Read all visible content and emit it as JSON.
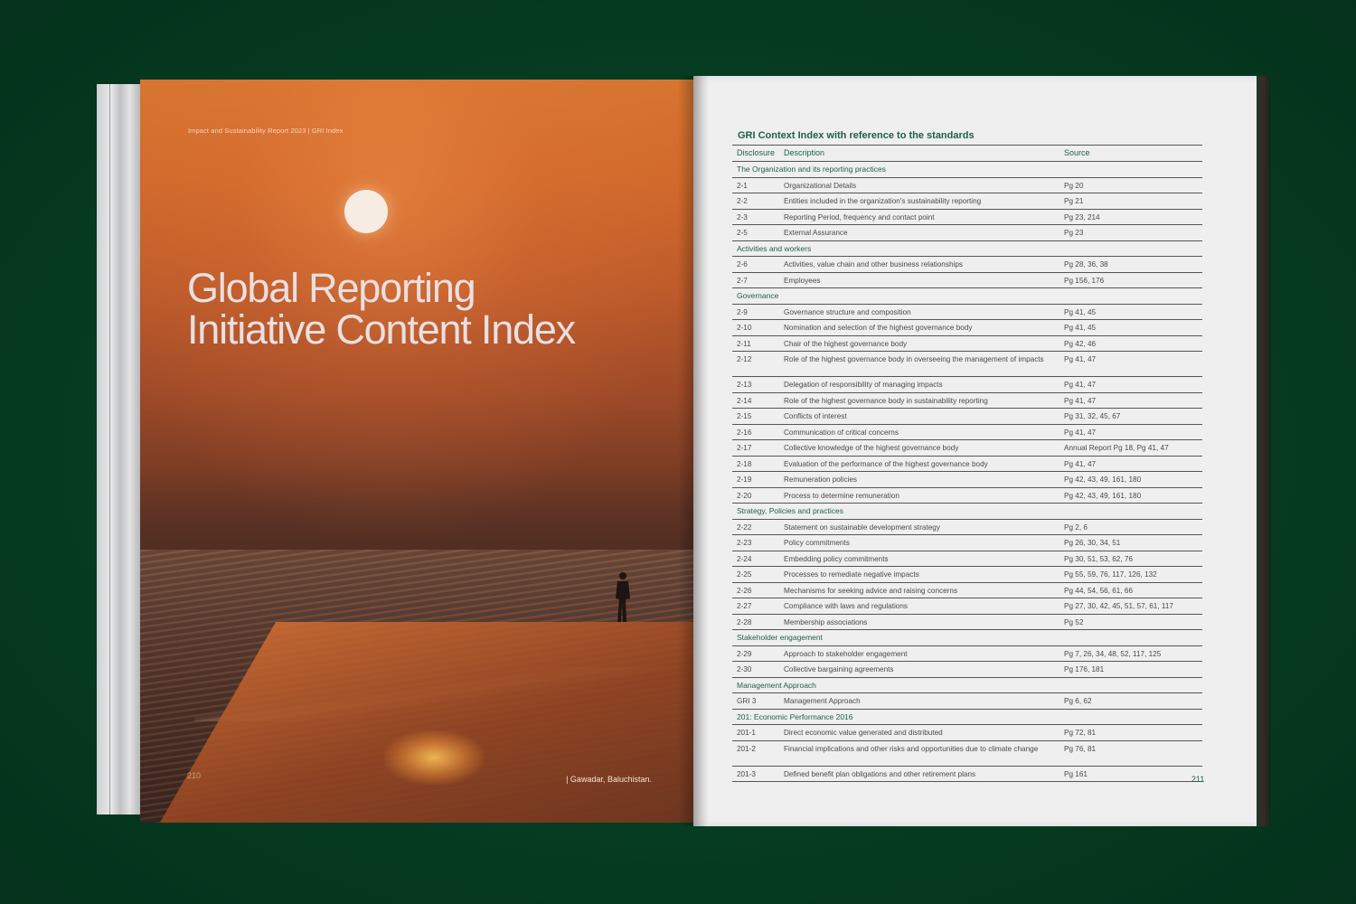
{
  "left_page": {
    "running_head": "Impact and Sustainability Report 2023 | GRI Index",
    "title_line1": "Global Reporting",
    "title_line2": "Initiative Content Index",
    "page_number": "210",
    "caption": "| Gawadar, Baluchistan."
  },
  "right_page": {
    "table_title": "GRI Context Index with reference to the standards",
    "headers": {
      "disclosure": "Disclosure",
      "description": "Description",
      "source": "Source"
    },
    "page_number": "211",
    "sections": [
      {
        "title": "The Organization and its reporting practices",
        "rows": [
          {
            "code": "2-1",
            "desc": "Organizational Details",
            "src": "Pg 20"
          },
          {
            "code": "2-2",
            "desc": "Entities included in the organization's sustainability reporting",
            "src": "Pg 21"
          },
          {
            "code": "2-3",
            "desc": "Reporting Period, frequency and contact point",
            "src": "Pg 23, 214"
          },
          {
            "code": "2-5",
            "desc": "External Assurance",
            "src": "Pg 23"
          }
        ]
      },
      {
        "title": "Activities and workers",
        "rows": [
          {
            "code": "2-6",
            "desc": "Activities, value chain and other business relationships",
            "src": "Pg 28, 36, 38"
          },
          {
            "code": "2-7",
            "desc": "Employees",
            "src": "Pg 156, 176"
          }
        ]
      },
      {
        "title": "Governance",
        "rows": [
          {
            "code": "2-9",
            "desc": "Governance structure and composition",
            "src": "Pg 41, 45"
          },
          {
            "code": "2-10",
            "desc": "Nomination and selection of the highest governance body",
            "src": "Pg 41, 45"
          },
          {
            "code": "2-11",
            "desc": "Chair of the highest governance body",
            "src": "Pg 42, 46"
          },
          {
            "code": "2-12",
            "desc": "Role of the highest governance body in overseeing the management of impacts",
            "src": "Pg 41, 47"
          },
          {
            "code": "2-13",
            "desc": "Delegation of responsibility of managing impacts",
            "src": "Pg 41, 47"
          },
          {
            "code": "2-14",
            "desc": "Role of the highest governance body in sustainability reporting",
            "src": "Pg 41, 47"
          },
          {
            "code": "2-15",
            "desc": "Conflicts of interest",
            "src": "Pg 31, 32, 45, 67"
          },
          {
            "code": "2-16",
            "desc": "Communication of critical concerns",
            "src": "Pg 41, 47"
          },
          {
            "code": "2-17",
            "desc": "Collective knowledge of the highest governance body",
            "src": "Annual Report Pg 18, Pg 41, 47"
          },
          {
            "code": "2-18",
            "desc": "Evaluation of the performance of the highest governance body",
            "src": "Pg 41, 47"
          },
          {
            "code": "2-19",
            "desc": "Remuneration policies",
            "src": "Pg 42, 43, 49, 161, 180"
          },
          {
            "code": "2-20",
            "desc": "Process to determine remuneration",
            "src": "Pg 42, 43, 49, 161, 180"
          }
        ]
      },
      {
        "title": "Strategy, Policies and practices",
        "rows": [
          {
            "code": "2-22",
            "desc": "Statement on sustainable development strategy",
            "src": "Pg 2, 6"
          },
          {
            "code": "2-23",
            "desc": "Policy commitments",
            "src": "Pg 26, 30, 34, 51"
          },
          {
            "code": "2-24",
            "desc": "Embedding policy commitments",
            "src": "Pg 30, 51, 53, 62, 76"
          },
          {
            "code": "2-25",
            "desc": "Processes to remediate negative impacts",
            "src": "Pg 55, 59, 76, 117, 126, 132"
          },
          {
            "code": "2-26",
            "desc": "Mechanisms for seeking advice and raising concerns",
            "src": "Pg 44, 54, 56, 61, 66"
          },
          {
            "code": "2-27",
            "desc": "Compliance with laws and regulations",
            "src": "Pg 27, 30, 42, 45, 51, 57, 61, 117"
          },
          {
            "code": "2-28",
            "desc": "Membership associations",
            "src": "Pg 52"
          }
        ]
      },
      {
        "title": "Stakeholder engagement",
        "rows": [
          {
            "code": "2-29",
            "desc": "Approach to stakeholder engagement",
            "src": "Pg 7, 26, 34, 48, 52, 117, 125"
          },
          {
            "code": "2-30",
            "desc": "Collective bargaining agreements",
            "src": "Pg 176, 181"
          }
        ]
      },
      {
        "title": "Management Approach",
        "rows": [
          {
            "code": "GRI 3",
            "desc": "Management Approach",
            "src": "Pg 6, 62"
          }
        ]
      },
      {
        "title": "201: Economic Performance 2016",
        "rows": [
          {
            "code": "201-1",
            "desc": "Direct economic value generated and distributed",
            "src": "Pg 72, 81"
          },
          {
            "code": "201-2",
            "desc": "Financial implications and other risks and opportunities due to climate change",
            "src": "Pg 76, 81"
          },
          {
            "code": "201-3",
            "desc": "Defined benefit plan obligations and other retirement plans",
            "src": "Pg 161"
          }
        ]
      }
    ]
  }
}
